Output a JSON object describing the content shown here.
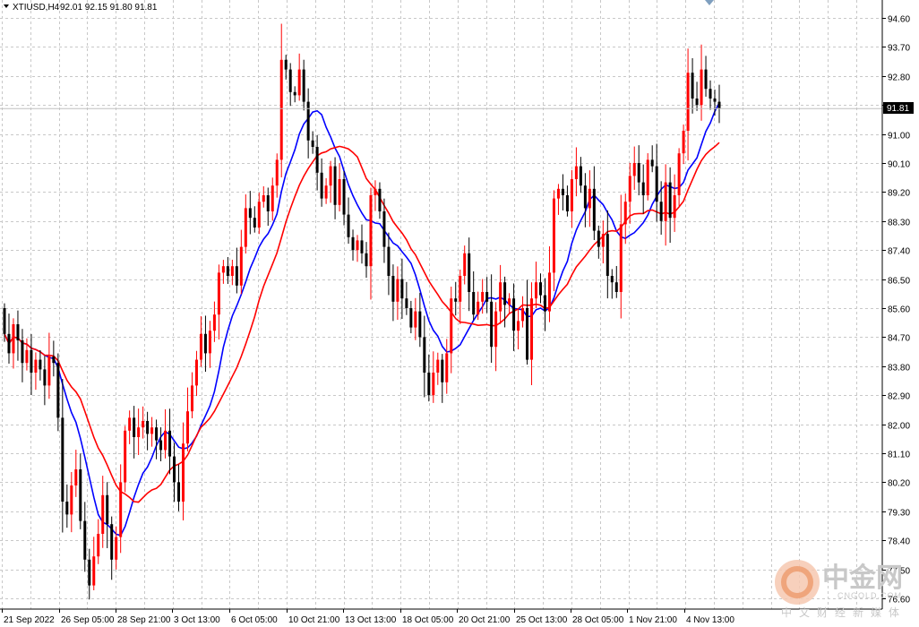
{
  "header": {
    "symbol": "XTIUSD,H4",
    "ohlc": "92.01 92.15 91.80 91.81"
  },
  "current_price_label": "91.81",
  "watermark": {
    "brand": "中金网",
    "site": "CNGOLD.COM",
    "tagline": "中文财经新媒体"
  },
  "colors": {
    "background": "#ffffff",
    "grid": "#c8c8c8",
    "bull": "#ff0000",
    "bear": "#000000",
    "ma_fast": "#0000ff",
    "ma_slow": "#ff0000",
    "price_line": "#c0c0c0"
  },
  "chart_data": {
    "type": "candlestick",
    "instrument": "XTIUSD",
    "timeframe": "H4",
    "y_ticks": [
      94.6,
      93.7,
      92.8,
      91.9,
      91.0,
      90.1,
      89.2,
      88.3,
      87.4,
      86.5,
      85.6,
      84.7,
      83.8,
      82.9,
      82.0,
      81.1,
      80.2,
      79.3,
      78.4,
      77.5,
      76.6
    ],
    "x_tick_labels": [
      "21 Sep 2022",
      "26 Sep 05:00",
      "28 Sep 21:00",
      "3 Oct 13:00",
      "6 Oct 05:00",
      "10 Oct 21:00",
      "13 Oct 13:00",
      "18 Oct 05:00",
      "20 Oct 21:00",
      "25 Oct 13:00",
      "28 Oct 05:00",
      "1 Nov 21:00",
      "4 Nov 13:00"
    ],
    "ylim": [
      76.1,
      95.5
    ],
    "close_series": [
      84.8,
      84.2,
      85.1,
      84.6,
      83.9,
      84.3,
      83.6,
      84.0,
      83.7,
      83.2,
      84.1,
      83.9,
      82.2,
      79.6,
      79.2,
      80.1,
      80.6,
      79.0,
      77.8,
      77.0,
      77.9,
      78.6,
      79.8,
      78.9,
      77.8,
      78.5,
      80.2,
      81.8,
      82.2,
      81.6,
      81.9,
      82.1,
      81.7,
      81.9,
      81.5,
      81.2,
      81.8,
      81.0,
      80.2,
      79.6,
      81.4,
      82.4,
      83.2,
      84.0,
      84.8,
      84.2,
      84.9,
      85.4,
      86.7,
      86.9,
      86.6,
      86.9,
      86.3,
      87.5,
      88.7,
      88.4,
      88.1,
      88.9,
      89.1,
      88.6,
      89.4,
      90.2,
      93.3,
      93.0,
      92.3,
      92.2,
      93.0,
      92.0,
      90.8,
      90.6,
      89.8,
      89.0,
      89.4,
      90.0,
      88.8,
      89.6,
      88.5,
      87.8,
      87.4,
      87.7,
      87.3,
      86.9,
      89.1,
      89.3,
      88.6,
      87.5,
      86.6,
      85.8,
      86.5,
      85.9,
      85.6,
      85.0,
      85.5,
      84.7,
      83.6,
      82.9,
      83.6,
      84.0,
      83.3,
      84.2,
      85.9,
      85.8,
      86.6,
      87.3,
      86.1,
      85.4,
      85.8,
      86.1,
      85.8,
      84.4,
      85.5,
      86.4,
      85.7,
      85.9,
      84.9,
      85.2,
      85.6,
      84.0,
      85.9,
      86.4,
      86.0,
      85.5,
      86.7,
      89.0,
      89.3,
      89.1,
      88.6,
      89.6,
      90.0,
      89.4,
      88.7,
      89.3,
      88.0,
      87.5,
      87.9,
      86.6,
      86.4,
      86.1,
      88.2,
      88.9,
      89.7,
      90.1,
      89.5,
      89.1,
      90.2,
      90.0,
      88.9,
      88.3,
      89.5,
      88.4,
      89.1,
      90.4,
      91.1,
      92.9,
      92.1,
      91.9,
      93.0,
      92.4,
      92.1,
      92.0,
      91.8
    ]
  },
  "indicators": {
    "ma_fast": {
      "name": "",
      "color": "#0000ff"
    },
    "ma_slow": {
      "name": "",
      "color": "#ff0000"
    }
  }
}
